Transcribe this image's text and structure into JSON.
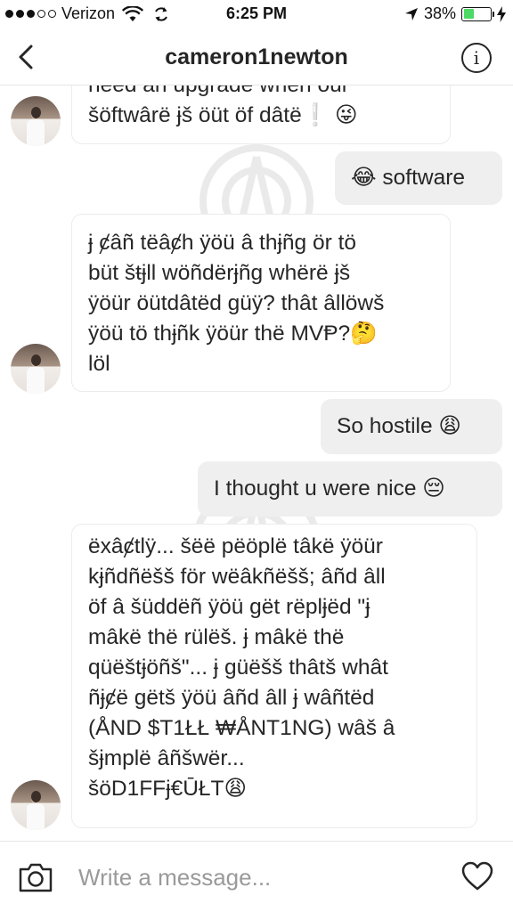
{
  "status_bar": {
    "carrier": "Verizon",
    "time": "6:25 PM",
    "battery_percent": "38%",
    "battery_level": 0.38,
    "icons": [
      "signal-dots-icon",
      "wifi-icon",
      "sync-icon",
      "location-arrow-icon",
      "battery-icon",
      "charging-bolt-icon"
    ]
  },
  "header": {
    "title": "cameron1newton",
    "back_icon": "chevron-left-icon",
    "info_icon": "info-icon"
  },
  "messages": [
    {
      "direction": "in",
      "lines": [
        "need an upgrade when our",
        "šöftwârë ɉš öüt öf dâtë❕ 😜"
      ],
      "avatar": true
    },
    {
      "direction": "out",
      "lines": [
        "😂 software"
      ]
    },
    {
      "direction": "in",
      "lines": [
        "ɉ ȼâñ tëâȼh ÿöü â thɉñg ör tö",
        "büt šŧɉll wöñdërɉñg whërë ɉš",
        "ÿöür öütdâtëd güÿ? thât âllöwš",
        "ÿöü tö thɉñk ÿöür thë MVⱣ?🤔",
        "löl"
      ],
      "avatar": true
    },
    {
      "direction": "out",
      "lines": [
        "So hostile 😩"
      ]
    },
    {
      "direction": "out",
      "lines": [
        "I thought u were nice 😔"
      ]
    },
    {
      "direction": "in",
      "lines": [
        "ëxâȼtlÿ... šëë pëöplë tâkë ÿöür",
        "kɉñdñëšš för wëâkñëšš; âñd âll",
        "öf â šüddëñ ÿöü gët rëplɉëd \"ɉ",
        "mâkë thë rülëš. ɉ mâkë thë",
        "qüëštɉöñš\"... ɉ güëšš thâtš whât",
        "ñɉȼë gëtš ÿöü âñd âll ɉ wâñtëd",
        "(ÅND $T1ŁŁ ₩ÅNT1NG) wâš â",
        "šɉmplë âñšwër...",
        "šöD1FFɉ€ŪŁT😩"
      ],
      "avatar": true
    }
  ],
  "composer": {
    "placeholder": "Write a message...",
    "camera_icon": "camera-icon",
    "heart_icon": "heart-icon"
  },
  "colors": {
    "incoming_bubble": "#ffffff",
    "outgoing_bubble": "#efefef",
    "text": "#262626",
    "placeholder": "#9a9a9a",
    "battery_fill": "#4cd964"
  }
}
